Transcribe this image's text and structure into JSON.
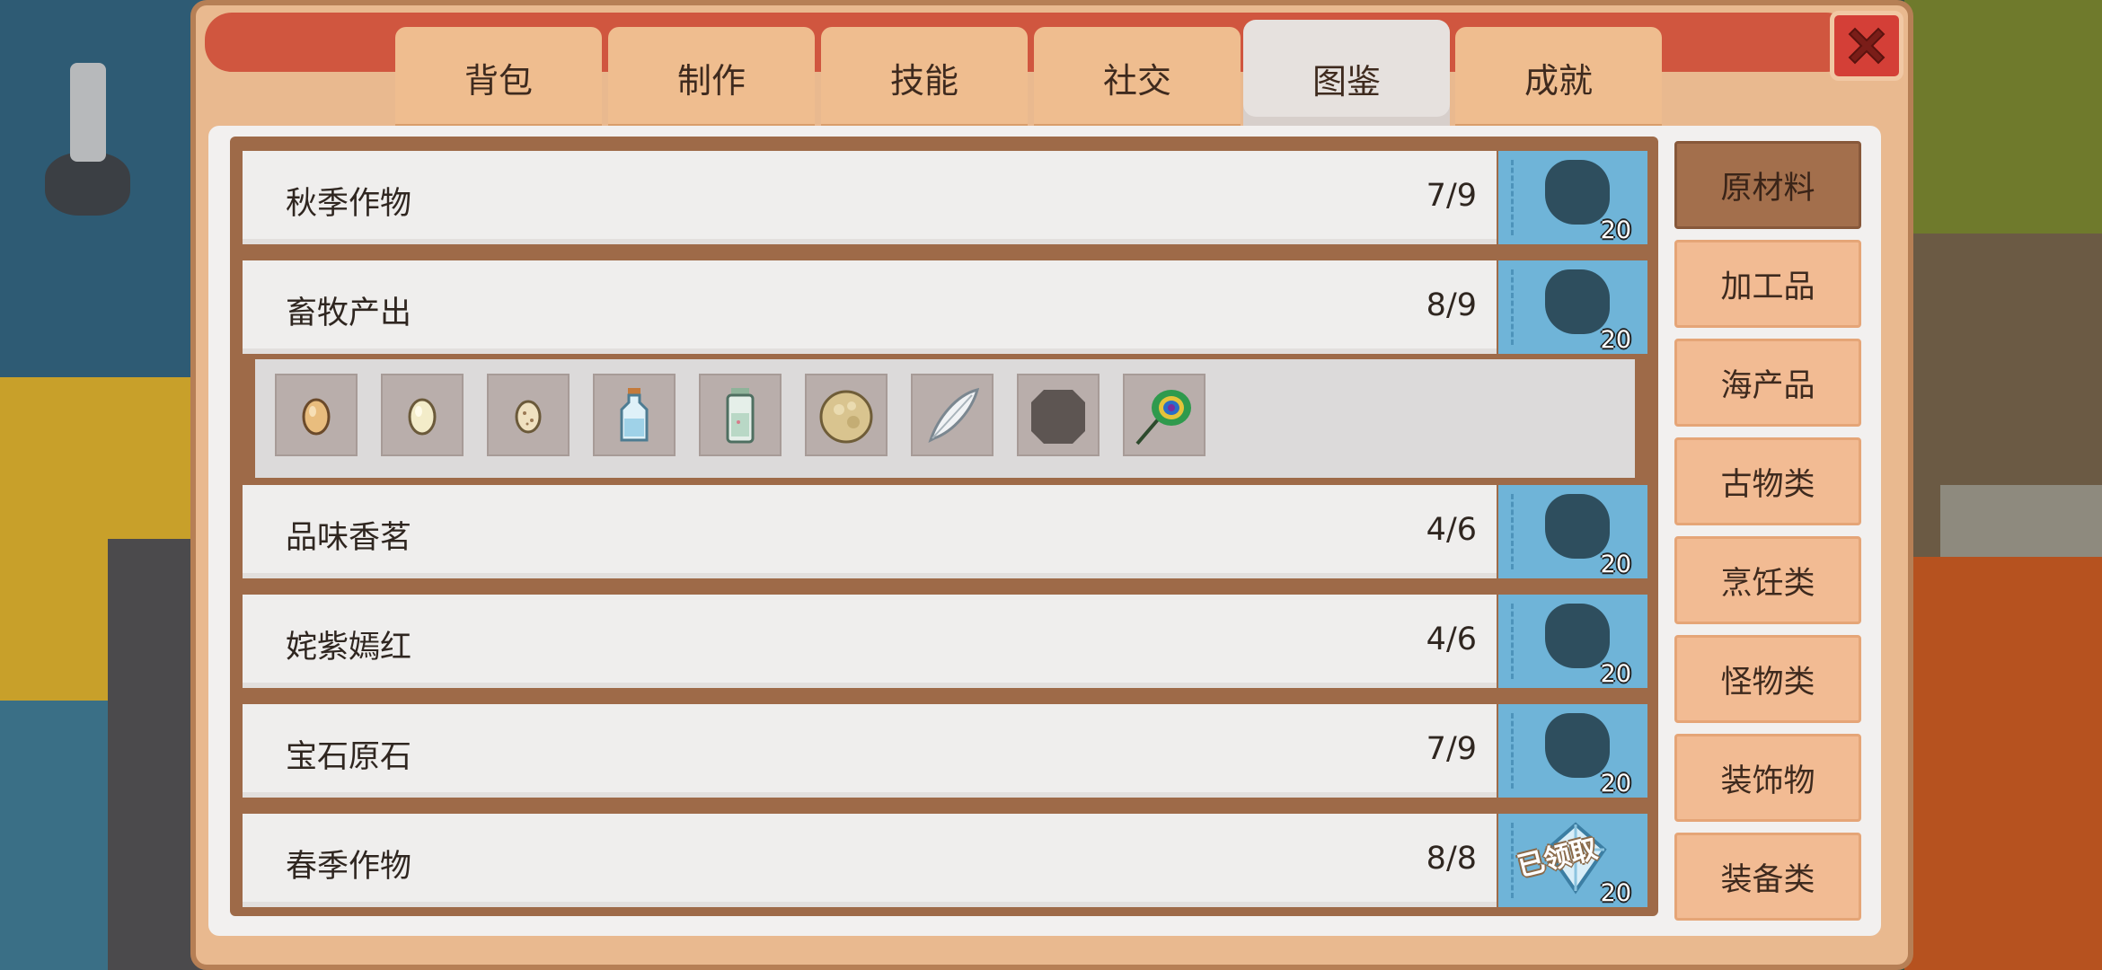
{
  "tabs": [
    "背包",
    "制作",
    "技能",
    "社交",
    "图鉴",
    "成就"
  ],
  "active_tab": "图鉴",
  "categories": [
    "原材料",
    "加工品",
    "海产品",
    "古物类",
    "烹饪类",
    "怪物类",
    "装饰物",
    "装备类"
  ],
  "active_category": "原材料",
  "collections": [
    {
      "title": "秋季作物",
      "count": "7/9",
      "reward": "20",
      "claimed": false
    },
    {
      "title": "畜牧产出",
      "count": "8/9",
      "reward": "20",
      "claimed": false
    },
    {
      "title": "品味香茗",
      "count": "4/6",
      "reward": "20",
      "claimed": false
    },
    {
      "title": "姹紫嫣红",
      "count": "4/6",
      "reward": "20",
      "claimed": false
    },
    {
      "title": "宝石原石",
      "count": "7/9",
      "reward": "20",
      "claimed": false
    },
    {
      "title": "春季作物",
      "count": "8/8",
      "reward": "20",
      "claimed": true,
      "claimed_label": "已领取"
    }
  ],
  "expanded_items": [
    {
      "icon": "brown-egg-icon"
    },
    {
      "icon": "white-egg-icon"
    },
    {
      "icon": "speckled-egg-icon"
    },
    {
      "icon": "milk-bottle-icon"
    },
    {
      "icon": "goat-milk-bottle-icon"
    },
    {
      "icon": "wool-icon"
    },
    {
      "icon": "feather-icon"
    },
    {
      "icon": "unknown-item-icon"
    },
    {
      "icon": "peacock-feather-icon"
    }
  ],
  "colors": {
    "accent_red": "#d0563f",
    "reward_blue": "#6fb4d8",
    "tab_orange": "#efbd8f",
    "cat_active": "#a36f4c"
  }
}
